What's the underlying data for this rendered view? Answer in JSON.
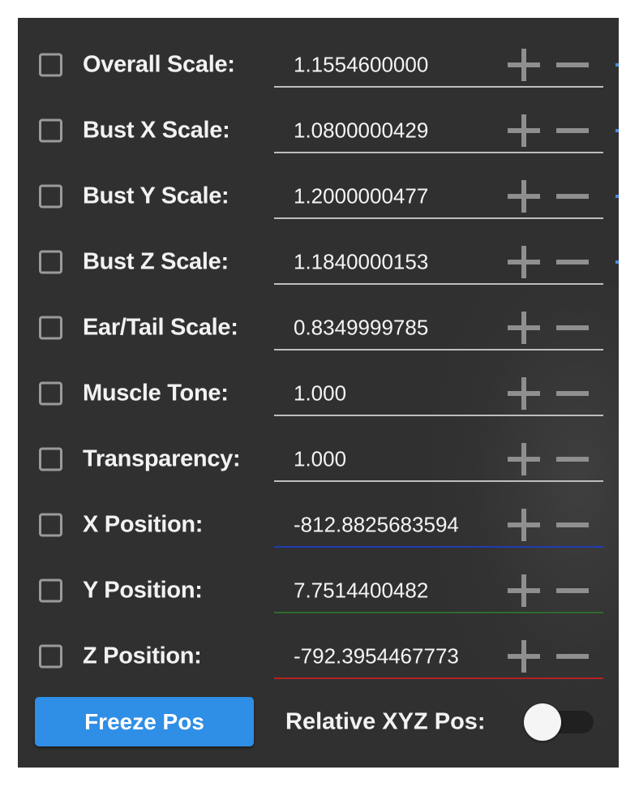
{
  "rows": [
    {
      "label": "Overall Scale:",
      "value": "1.1554600000",
      "underline": "gray"
    },
    {
      "label": "Bust X Scale:",
      "value": "1.0800000429",
      "underline": "gray"
    },
    {
      "label": "Bust Y Scale:",
      "value": "1.2000000477",
      "underline": "gray"
    },
    {
      "label": "Bust Z Scale:",
      "value": "1.1840000153",
      "underline": "gray"
    },
    {
      "label": "Ear/Tail Scale:",
      "value": "0.8349999785",
      "underline": "gray"
    },
    {
      "label": "Muscle Tone:",
      "value": "1.000",
      "underline": "gray"
    },
    {
      "label": "Transparency:",
      "value": "1.000",
      "underline": "gray"
    },
    {
      "label": "X Position:",
      "value": "-812.8825683594",
      "underline": "#1f3db0"
    },
    {
      "label": "Y Position:",
      "value": "7.7514400482",
      "underline": "#2f6b2f"
    },
    {
      "label": "Z Position:",
      "value": "-792.3954467773",
      "underline": "#b32222"
    }
  ],
  "footer": {
    "freeze_button_label": "Freeze Pos",
    "relative_label": "Relative XYZ Pos:",
    "relative_toggle_on": false
  },
  "colors": {
    "panel_bg": "#303030",
    "accent_button": "#2f8ee6",
    "x_axis": "#1f3db0",
    "y_axis": "#2f6b2f",
    "z_axis": "#b32222"
  },
  "icons": {
    "increment": "plus-icon",
    "decrement": "minus-icon"
  }
}
